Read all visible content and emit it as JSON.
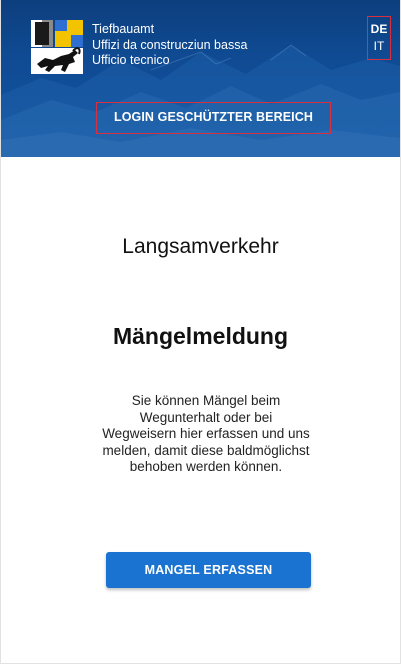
{
  "header": {
    "office_lines": [
      "Tiefbauamt",
      "Uffizi da construcziun bassa",
      "Ufficio tecnico"
    ],
    "languages": {
      "active": "DE",
      "other": "IT"
    },
    "login_label": "LOGIN GESCHÜTZTER BEREICH"
  },
  "main": {
    "subtitle": "Langsamverkehr",
    "title": "Mängelmeldung",
    "description": "Sie können Mängel beim Wegunterhalt oder bei Wegweisern hier erfassen und uns melden, damit diese baldmöglichst behoben werden können.",
    "primary_button": "MANGEL ERFASSEN"
  },
  "colors": {
    "header_blue": "#114f9a",
    "highlight_red": "#d9303f",
    "button_blue": "#1a73d0"
  },
  "icons": [
    "graubuenden-coat-of-arms-icon"
  ]
}
